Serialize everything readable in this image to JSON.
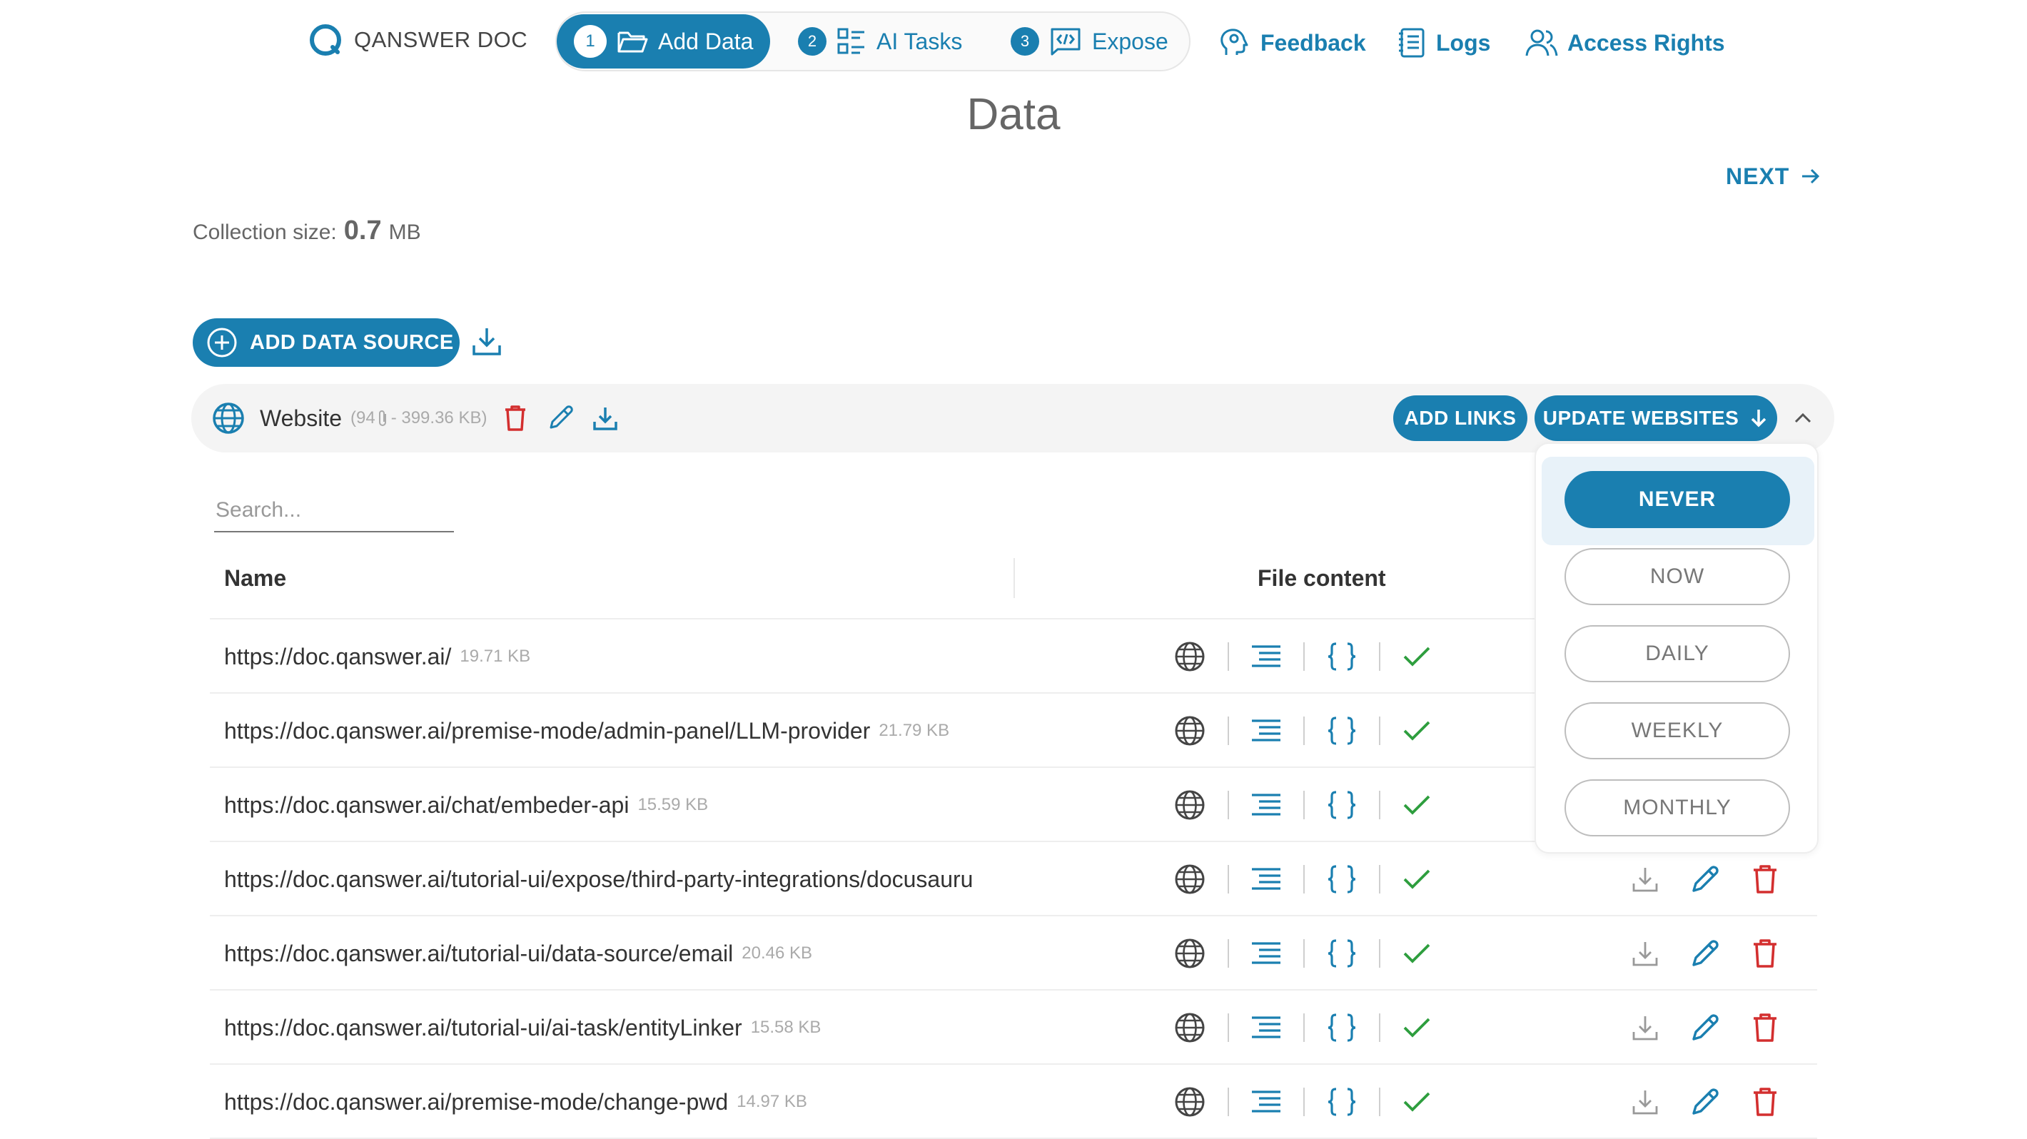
{
  "brand": {
    "name": "QANSWER DOC"
  },
  "steps": [
    {
      "num": "1",
      "label": "Add Data",
      "icon": "folder-open-icon"
    },
    {
      "num": "2",
      "label": "AI Tasks",
      "icon": "tasks-list-icon"
    },
    {
      "num": "3",
      "label": "Expose",
      "icon": "code-window-icon"
    }
  ],
  "nav": {
    "feedback": "Feedback",
    "logs": "Logs",
    "access_rights": "Access Rights"
  },
  "page": {
    "title": "Data",
    "next_label": "NEXT",
    "collection_label": "Collection size:",
    "collection_value": "0.7",
    "collection_unit": "MB"
  },
  "toolbar": {
    "add_source_label": "ADD DATA SOURCE"
  },
  "source": {
    "title": "Website",
    "meta_open": "(94",
    "meta_rest": "- 399.36 KB)",
    "add_links_label": "ADD LINKS",
    "update_label": "UPDATE WEBSITES"
  },
  "search": {
    "placeholder": "Search..."
  },
  "table": {
    "columns": {
      "name": "Name",
      "file_content": "File content"
    },
    "rows": [
      {
        "url": "https://doc.qanswer.ai/",
        "size": "19.71 KB"
      },
      {
        "url": "https://doc.qanswer.ai/premise-mode/admin-panel/LLM-provider",
        "size": "21.79 KB"
      },
      {
        "url": "https://doc.qanswer.ai/chat/embeder-api",
        "size": "15.59 KB"
      },
      {
        "url": "https://doc.qanswer.ai/tutorial-ui/expose/third-party-integrations/docusauru",
        "size": ""
      },
      {
        "url": "https://doc.qanswer.ai/tutorial-ui/data-source/email",
        "size": "20.46 KB"
      },
      {
        "url": "https://doc.qanswer.ai/tutorial-ui/ai-task/entityLinker",
        "size": "15.58 KB"
      },
      {
        "url": "https://doc.qanswer.ai/premise-mode/change-pwd",
        "size": "14.97 KB"
      }
    ]
  },
  "update_dropdown": {
    "selected": "NEVER",
    "options": [
      "NEVER",
      "NOW",
      "DAILY",
      "WEEKLY",
      "MONTHLY"
    ]
  },
  "colors": {
    "accent": "#1a7fb0",
    "success": "#2e9e3e",
    "danger": "#d32f2f"
  }
}
